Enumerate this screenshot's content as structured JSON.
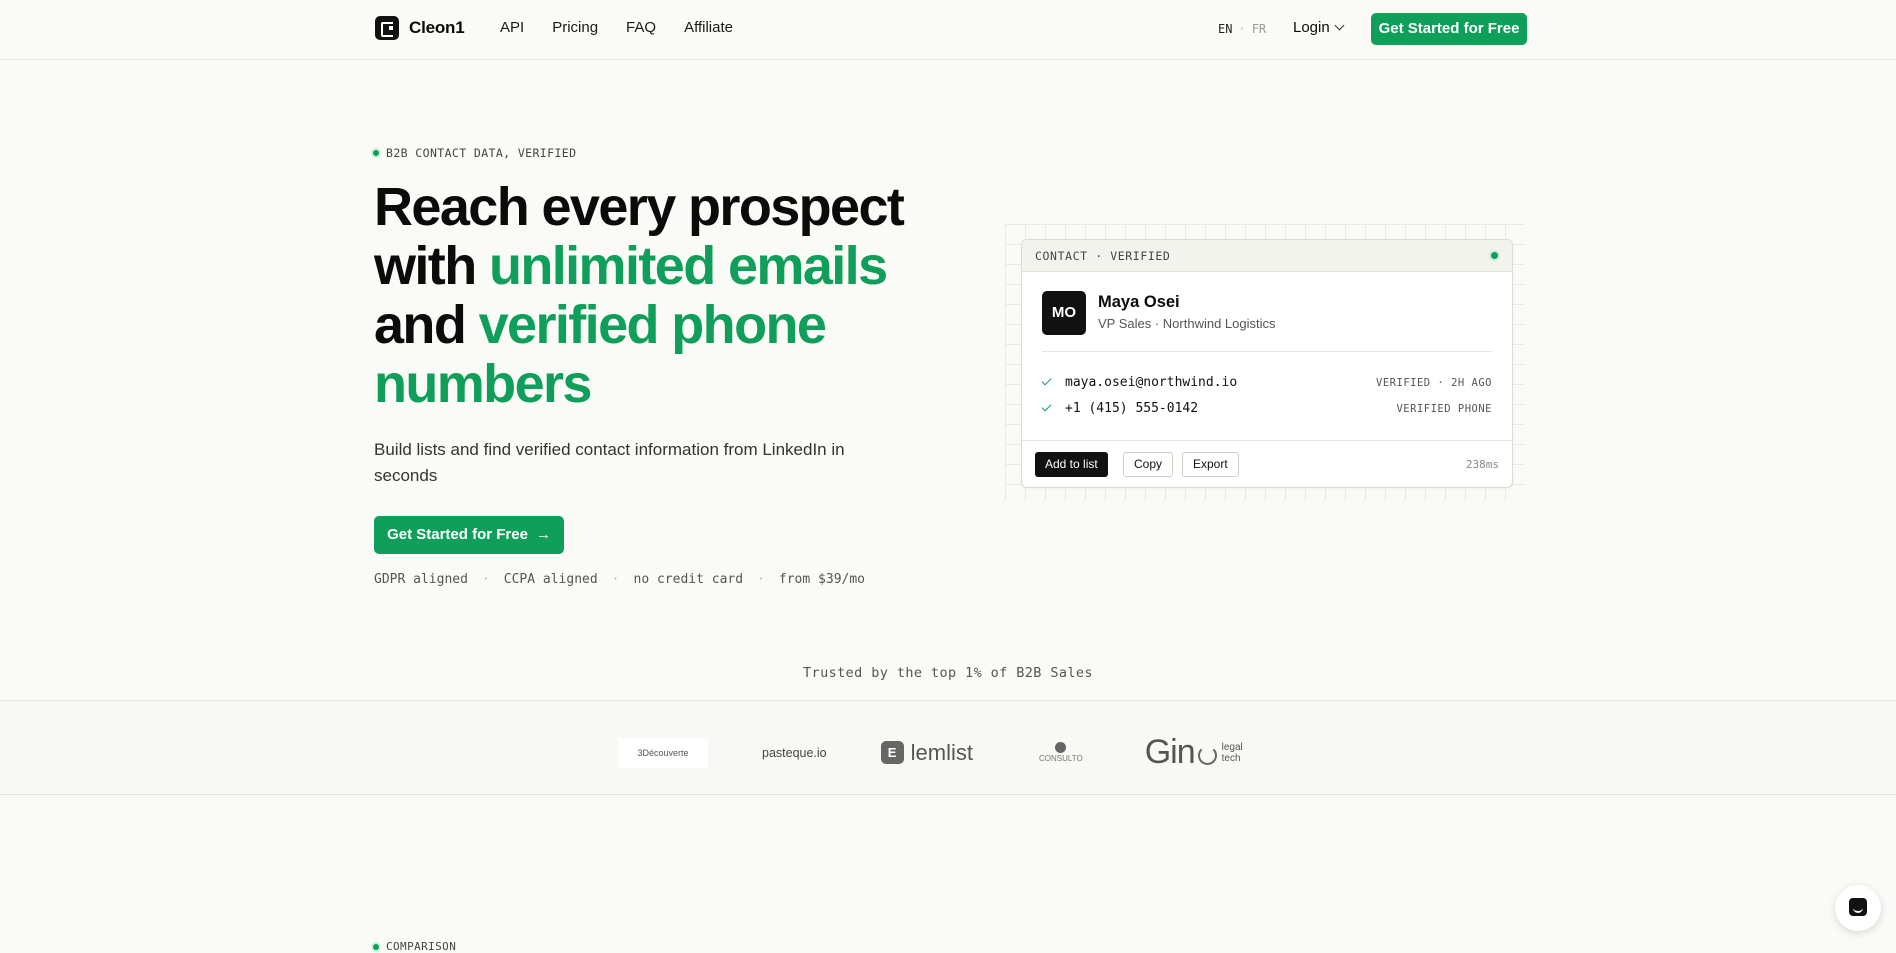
{
  "nav": {
    "brand": "Cleon1",
    "links": [
      "API",
      "Pricing",
      "FAQ",
      "Affiliate"
    ],
    "lang_active": "EN",
    "lang_sep": "·",
    "lang_other": "FR",
    "login": "Login",
    "cta": "Get Started for Free"
  },
  "hero": {
    "eyebrow": "B2B CONTACT DATA, VERIFIED",
    "headline": {
      "p1": "Reach every prospect with ",
      "g1": "unlimited emails",
      "p2": " and ",
      "g2": "verified phone numbers"
    },
    "subtitle": "Build lists and find verified contact information from LinkedIn in seconds",
    "cta": "Get Started for Free",
    "cta_arrow": "→",
    "badges": [
      "GDPR aligned",
      "CCPA aligned",
      "no credit card",
      "from $39/mo"
    ],
    "badge_sep": "·"
  },
  "card": {
    "header": "CONTACT · VERIFIED",
    "initials": "MO",
    "name": "Maya Osei",
    "role": "VP Sales · Northwind Logistics",
    "email": "maya.osei@northwind.io",
    "email_tag": "VERIFIED · 2H AGO",
    "phone": "+1 (415) 555-0142",
    "phone_tag": "VERIFIED PHONE",
    "actions": {
      "add": "Add to list",
      "copy": "Copy",
      "export": "Export"
    },
    "latency": "238ms"
  },
  "trust": {
    "caption": "Trusted by the top 1% of B2B Sales",
    "logos": {
      "l1": "3Découverte",
      "l2": "pasteque.io",
      "l3_mark": "E",
      "l3": "lemlist",
      "l4": "CONSULTO",
      "l5": "Gin",
      "l5_sub1": "legal",
      "l5_sub2": "tech"
    }
  },
  "next_section": "COMPARISON",
  "colors": {
    "accent": "#0f9f5a",
    "ink": "#0b0b0b",
    "background": "#fafaf7"
  }
}
